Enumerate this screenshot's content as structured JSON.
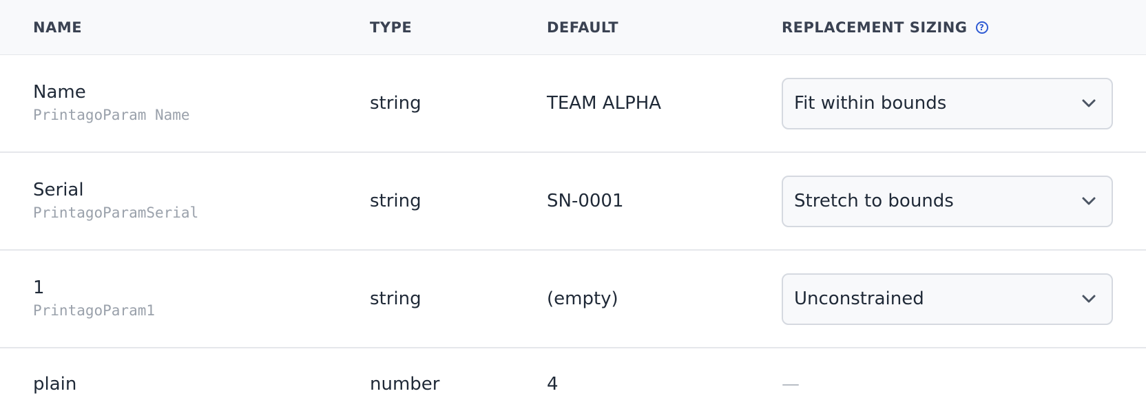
{
  "header": {
    "name": "NAME",
    "type": "TYPE",
    "default": "DEFAULT",
    "sizing": "REPLACEMENT SIZING",
    "help_glyph": "?"
  },
  "rows": [
    {
      "name": "Name",
      "param": "PrintagoParam Name",
      "type": "string",
      "default": "TEAM ALPHA",
      "sizing": "Fit within bounds"
    },
    {
      "name": "Serial",
      "param": "PrintagoParamSerial",
      "type": "string",
      "default": "SN-0001",
      "sizing": "Stretch to bounds"
    },
    {
      "name": "1",
      "param": "PrintagoParam1",
      "type": "string",
      "default": "(empty)",
      "sizing": "Unconstrained"
    },
    {
      "name": "plain",
      "type": "number",
      "default": "4",
      "sizing_placeholder": "—"
    }
  ],
  "icons": {
    "help": "question-circle-icon",
    "dropdown": "chevron-down-icon"
  },
  "colors": {
    "accent": "#2f5bd3",
    "header_bg": "#f8f9fb",
    "border": "#e5e7eb",
    "muted_text": "#9aa1ab"
  }
}
